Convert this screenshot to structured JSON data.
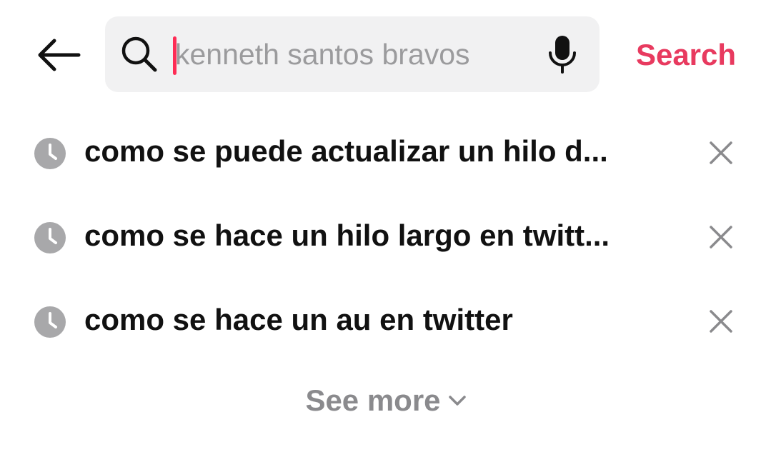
{
  "header": {
    "back_icon": "arrow-left-icon",
    "search": {
      "placeholder": "kenneth santos bravos",
      "value": "",
      "search_icon": "search-icon",
      "mic_icon": "microphone-icon"
    },
    "search_button_label": "Search"
  },
  "history": {
    "items": [
      {
        "text": "como se puede actualizar un hilo d...",
        "icon": "clock-icon",
        "remove_icon": "close-icon"
      },
      {
        "text": "como se hace un hilo largo en twitt...",
        "icon": "clock-icon",
        "remove_icon": "close-icon"
      },
      {
        "text": "como se hace un au en twitter",
        "icon": "clock-icon",
        "remove_icon": "close-icon"
      }
    ]
  },
  "see_more": {
    "label": "See more",
    "icon": "chevron-down-icon"
  },
  "colors": {
    "accent": "#fe2c55",
    "search_label": "#e83a5f",
    "search_bg": "#f1f1f2",
    "placeholder": "#9b9b9d",
    "history_icon": "#a8a8aa",
    "text": "#111111",
    "muted": "#8a8a8d"
  }
}
